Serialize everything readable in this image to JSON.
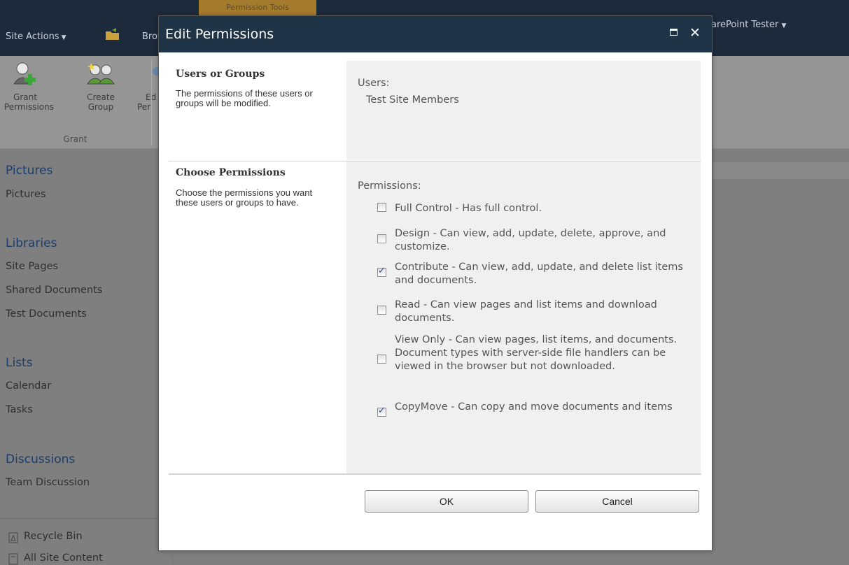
{
  "topbar": {
    "contextual_tab": "Permission Tools",
    "site_actions": "Site Actions",
    "browse_tab": "Browse",
    "user_menu": "arePoint Tester"
  },
  "ribbon": {
    "buttons": [
      {
        "label_1": "Grant",
        "label_2": "Permissions"
      },
      {
        "label_1": "Create",
        "label_2": "Group"
      },
      {
        "label_1": "Ed",
        "label_2": "Per"
      }
    ],
    "group_label": "Grant"
  },
  "leftnav": {
    "sections": [
      {
        "heading": "Pictures",
        "items": [
          "Pictures"
        ]
      },
      {
        "heading": "Libraries",
        "items": [
          "Site Pages",
          "Shared Documents",
          "Test Documents"
        ]
      },
      {
        "heading": "Lists",
        "items": [
          "Calendar",
          "Tasks"
        ]
      },
      {
        "heading": "Discussions",
        "items": [
          "Team Discussion"
        ]
      }
    ],
    "recycle_bin": "Recycle Bin",
    "all_site_content": "All Site Content"
  },
  "dialog": {
    "title": "Edit Permissions",
    "users_section": {
      "title": "Users or Groups",
      "description": "The permissions of these users or groups will be modified.",
      "field_label": "Users:",
      "field_value": "Test Site Members"
    },
    "permissions_section": {
      "title": "Choose Permissions",
      "description": "Choose the permissions you want these users or groups to have.",
      "field_label": "Permissions:",
      "options": [
        {
          "text": "Full Control - Has full control.",
          "checked": false
        },
        {
          "text": "Design - Can view, add, update, delete, approve, and customize.",
          "checked": false
        },
        {
          "text": "Contribute - Can view, add, update, and delete list items and documents.",
          "checked": true
        },
        {
          "text": "Read - Can view pages and list items and download documents.",
          "checked": false
        },
        {
          "text": "View Only - Can view pages, list items, and documents. Document types with server-side file handlers can be viewed in the browser but not downloaded.",
          "checked": false
        },
        {
          "text": "CopyMove - Can copy and move documents and items",
          "checked": true
        }
      ]
    },
    "ok_label": "OK",
    "cancel_label": "Cancel"
  }
}
